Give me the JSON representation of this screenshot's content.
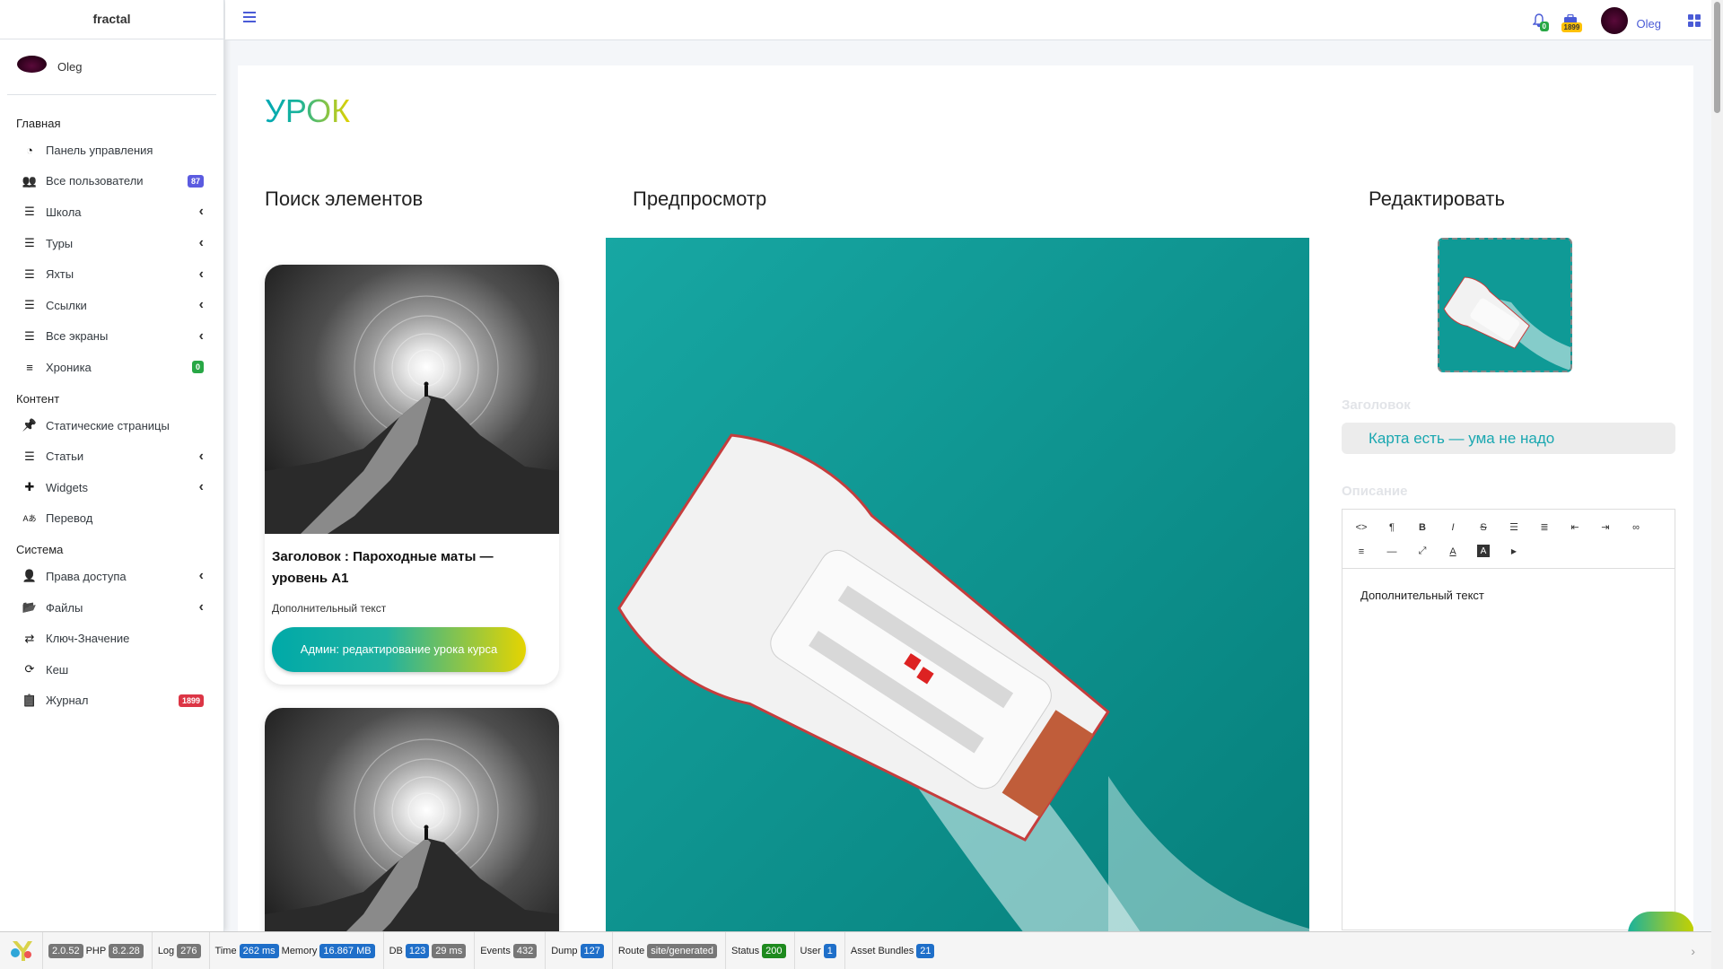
{
  "brand": "fractal",
  "user": {
    "name": "Oleg"
  },
  "sidebar": {
    "sections": [
      {
        "header": "Главная",
        "items": [
          {
            "label": "Панель управления",
            "icon": "dashboard-icon",
            "badge": "",
            "caret": false
          },
          {
            "label": "Все пользователи",
            "icon": "users-icon",
            "badge": "87",
            "badge_color": "blue",
            "caret": false
          },
          {
            "label": "Школа",
            "icon": "list-icon",
            "badge": "",
            "caret": true
          },
          {
            "label": "Туры",
            "icon": "list-icon",
            "badge": "",
            "caret": true
          },
          {
            "label": "Яхты",
            "icon": "list-icon",
            "badge": "",
            "caret": true
          },
          {
            "label": "Ссылки",
            "icon": "list-icon",
            "badge": "",
            "caret": true
          },
          {
            "label": "Все экраны",
            "icon": "list-icon",
            "badge": "",
            "caret": true
          },
          {
            "label": "Хроника",
            "icon": "stream-icon",
            "badge": "0",
            "badge_color": "green",
            "caret": false
          }
        ]
      },
      {
        "header": "Контент",
        "items": [
          {
            "label": "Статические страницы",
            "icon": "pin-icon",
            "badge": "",
            "caret": false
          },
          {
            "label": "Статьи",
            "icon": "list-icon",
            "badge": "",
            "caret": true
          },
          {
            "label": "Widgets",
            "icon": "puzzle-icon",
            "badge": "",
            "caret": true
          },
          {
            "label": "Перевод",
            "icon": "language-icon",
            "badge": "",
            "caret": false
          }
        ]
      },
      {
        "header": "Система",
        "items": [
          {
            "label": "Права доступа",
            "icon": "user-lock-icon",
            "badge": "",
            "caret": true
          },
          {
            "label": "Файлы",
            "icon": "folder-icon",
            "badge": "",
            "caret": true
          },
          {
            "label": "Ключ-Значение",
            "icon": "exchange-icon",
            "badge": "",
            "caret": false
          },
          {
            "label": "Кеш",
            "icon": "sync-icon",
            "badge": "",
            "caret": false
          },
          {
            "label": "Журнал",
            "icon": "clipboard-icon",
            "badge": "1899",
            "badge_color": "red",
            "caret": false
          }
        ]
      }
    ]
  },
  "topbar": {
    "notifications_count": "0",
    "log_count": "1899",
    "user_name": "Oleg"
  },
  "page": {
    "title": "УРОК",
    "col_search": "Поиск элементов",
    "col_preview": "Предпросмотр",
    "col_edit": "Редактировать"
  },
  "element_cards": [
    {
      "title": "Заголовок : Пароходные маты — уровень А1",
      "text": "Дополнительный текст",
      "button": "Админ: редактирование урока курса"
    }
  ],
  "editor": {
    "heading_label": "Заголовок",
    "heading_value": "Карта есть — ума не надо",
    "description_label": "Описание",
    "content": "Дополнительный текст",
    "toolbar_icons": [
      "code-view-icon",
      "paragraph-icon",
      "bold-icon",
      "italic-icon",
      "strikethrough-icon",
      "unordered-list-icon",
      "ordered-list-icon",
      "outdent-icon",
      "indent-icon",
      "link-icon",
      "align-icon",
      "horizontal-rule-icon",
      "fullscreen-icon",
      "font-color-icon",
      "background-color-icon",
      "video-icon"
    ]
  },
  "debugbar": {
    "version": "2.0.52",
    "php_label": "PHP",
    "php_version": "8.2.28",
    "log_label": "Log",
    "log_value": "276",
    "time_label": "Time",
    "time_value": "262 ms",
    "memory_label": "Memory",
    "memory_value": "16.867 MB",
    "db_label": "DB",
    "db_queries": "123",
    "db_time": "29 ms",
    "events_label": "Events",
    "events_value": "432",
    "dump_label": "Dump",
    "dump_value": "127",
    "route_label": "Route",
    "route_value": "site/generated",
    "status_label": "Status",
    "status_value": "200",
    "user_label": "User",
    "user_value": "1",
    "assets_label": "Asset Bundles",
    "assets_value": "21"
  }
}
